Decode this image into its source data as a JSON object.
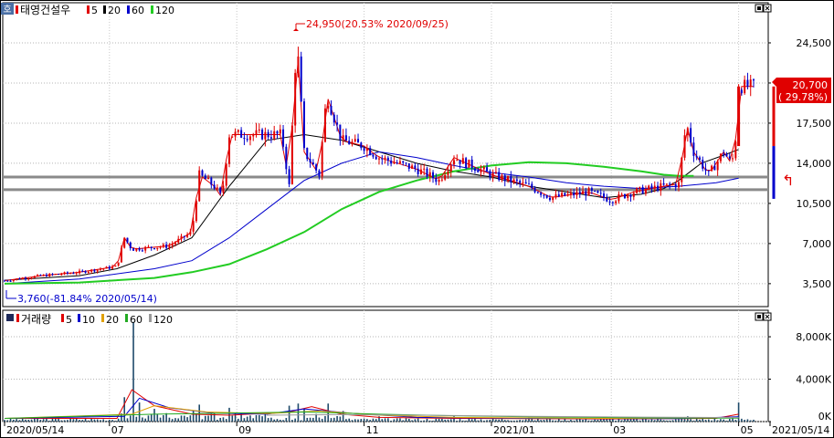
{
  "price_panel": {
    "badge": "호",
    "legend": {
      "name": "태영건설우",
      "ma_labels": [
        "5",
        "20",
        "60",
        "120"
      ],
      "ma_colors": [
        "#e00000",
        "#000000",
        "#0000cc",
        "#22cc22"
      ]
    },
    "y_ticks": [
      "24,500",
      "21,000",
      "17,500",
      "14,000",
      "10,500",
      "7,000",
      "3,500"
    ],
    "y_tick_values": [
      24500,
      21000,
      17500,
      14000,
      10500,
      7000,
      3500
    ],
    "ylim": [
      1500,
      28000
    ],
    "high_annotation": "24,950(20.53% 2020/09/25)",
    "low_annotation": "3,760(-81.84% 2020/05/14)",
    "current_price": "20,700",
    "current_change": "( 29.78%)",
    "arrow_glyph": "↰"
  },
  "volume_panel": {
    "legend": {
      "name": "거래량",
      "ma_labels": [
        "5",
        "10",
        "20",
        "60",
        "120"
      ],
      "ma_colors": [
        "#e00000",
        "#0000cc",
        "#e0a000",
        "#22aa22",
        "#999999"
      ]
    },
    "y_ticks": [
      "8,000K",
      "4,000K",
      "0K"
    ],
    "y_tick_values": [
      8000,
      4000,
      0
    ],
    "ylim": [
      0,
      10500
    ]
  },
  "x_axis": {
    "labels": [
      "2020/05/14",
      "07",
      "09",
      "11",
      "2021/01",
      "03",
      "05",
      "2021/05/14"
    ],
    "positions": [
      0,
      0.14,
      0.31,
      0.48,
      0.65,
      0.81,
      0.98,
      1.0
    ]
  },
  "chart_data": [
    {
      "type": "candlestick",
      "title": "태영건설우",
      "series": [
        {
          "name": "5",
          "color": "#e00000"
        },
        {
          "name": "20",
          "color": "#000000"
        },
        {
          "name": "60",
          "color": "#0000cc"
        },
        {
          "name": "120",
          "color": "#22cc22"
        }
      ],
      "x_range": [
        "2020/05/14",
        "2021/05/14"
      ],
      "ylim": [
        1500,
        28000
      ],
      "y_ticks": [
        24500,
        21000,
        17500,
        14000,
        10500,
        7000,
        3500
      ],
      "x_ticks": [
        "2020/05/14",
        "07",
        "09",
        "11",
        "2021/01",
        "03",
        "05",
        "2021/05/14"
      ],
      "price_path": [
        [
          0,
          3760
        ],
        [
          0.05,
          4200
        ],
        [
          0.1,
          4500
        ],
        [
          0.15,
          5000
        ],
        [
          0.16,
          7500
        ],
        [
          0.17,
          6500
        ],
        [
          0.22,
          6800
        ],
        [
          0.25,
          8000
        ],
        [
          0.26,
          13000
        ],
        [
          0.28,
          12000
        ],
        [
          0.29,
          11000
        ],
        [
          0.3,
          16500
        ],
        [
          0.31,
          16500
        ],
        [
          0.37,
          16500
        ],
        [
          0.38,
          12000
        ],
        [
          0.39,
          24950
        ],
        [
          0.4,
          15000
        ],
        [
          0.42,
          13000
        ],
        [
          0.43,
          20000
        ],
        [
          0.45,
          16000
        ],
        [
          0.48,
          15500
        ],
        [
          0.5,
          14500
        ],
        [
          0.55,
          13500
        ],
        [
          0.58,
          12500
        ],
        [
          0.6,
          14500
        ],
        [
          0.65,
          13000
        ],
        [
          0.7,
          12000
        ],
        [
          0.73,
          11000
        ],
        [
          0.78,
          11500
        ],
        [
          0.81,
          10800
        ],
        [
          0.84,
          11500
        ],
        [
          0.88,
          12000
        ],
        [
          0.9,
          12200
        ],
        [
          0.91,
          17500
        ],
        [
          0.92,
          15000
        ],
        [
          0.94,
          13000
        ],
        [
          0.96,
          15000
        ],
        [
          0.97,
          14000
        ],
        [
          0.975,
          15000
        ],
        [
          0.98,
          20700
        ]
      ],
      "ma_paths": {
        "20": [
          [
            0,
            3800
          ],
          [
            0.1,
            4200
          ],
          [
            0.15,
            4800
          ],
          [
            0.2,
            6000
          ],
          [
            0.25,
            7500
          ],
          [
            0.3,
            12000
          ],
          [
            0.35,
            16000
          ],
          [
            0.4,
            16500
          ],
          [
            0.45,
            16000
          ],
          [
            0.5,
            15000
          ],
          [
            0.55,
            14000
          ],
          [
            0.6,
            13300
          ],
          [
            0.65,
            12800
          ],
          [
            0.7,
            12000
          ],
          [
            0.75,
            11500
          ],
          [
            0.8,
            11000
          ],
          [
            0.85,
            11300
          ],
          [
            0.88,
            11800
          ],
          [
            0.9,
            12500
          ],
          [
            0.93,
            14000
          ],
          [
            0.96,
            14700
          ],
          [
            0.98,
            15200
          ]
        ],
        "60": [
          [
            0,
            3500
          ],
          [
            0.1,
            3900
          ],
          [
            0.2,
            4800
          ],
          [
            0.25,
            5500
          ],
          [
            0.3,
            7500
          ],
          [
            0.35,
            10000
          ],
          [
            0.4,
            12500
          ],
          [
            0.45,
            14000
          ],
          [
            0.5,
            15000
          ],
          [
            0.55,
            14500
          ],
          [
            0.6,
            13800
          ],
          [
            0.65,
            13200
          ],
          [
            0.7,
            12800
          ],
          [
            0.75,
            12300
          ],
          [
            0.8,
            12000
          ],
          [
            0.85,
            11800
          ],
          [
            0.9,
            12000
          ],
          [
            0.95,
            12300
          ],
          [
            0.98,
            12700
          ]
        ],
        "120": [
          [
            0,
            3500
          ],
          [
            0.1,
            3600
          ],
          [
            0.2,
            4000
          ],
          [
            0.25,
            4500
          ],
          [
            0.3,
            5200
          ],
          [
            0.35,
            6500
          ],
          [
            0.4,
            8000
          ],
          [
            0.45,
            10000
          ],
          [
            0.5,
            11500
          ],
          [
            0.55,
            12500
          ],
          [
            0.6,
            13300
          ],
          [
            0.65,
            13800
          ],
          [
            0.7,
            14100
          ],
          [
            0.75,
            14000
          ],
          [
            0.8,
            13700
          ],
          [
            0.85,
            13300
          ],
          [
            0.88,
            13000
          ],
          [
            0.9,
            12900
          ],
          [
            0.92,
            12900
          ]
        ]
      },
      "support_lines": [
        12800,
        11700
      ]
    },
    {
      "type": "bar",
      "title": "거래량",
      "series": [
        {
          "name": "5",
          "color": "#e00000"
        },
        {
          "name": "10",
          "color": "#0000cc"
        },
        {
          "name": "20",
          "color": "#e0a000"
        },
        {
          "name": "60",
          "color": "#22aa22"
        },
        {
          "name": "120",
          "color": "#999999"
        }
      ],
      "unit": "K",
      "ylim": [
        0,
        10500
      ],
      "y_ticks": [
        8000,
        4000,
        0
      ],
      "spikes": [
        [
          0.16,
          2300
        ],
        [
          0.17,
          9400
        ],
        [
          0.18,
          1800
        ],
        [
          0.2,
          1200
        ],
        [
          0.25,
          1000
        ],
        [
          0.26,
          1600
        ],
        [
          0.28,
          800
        ],
        [
          0.3,
          1300
        ],
        [
          0.38,
          1500
        ],
        [
          0.39,
          1700
        ],
        [
          0.4,
          1200
        ],
        [
          0.43,
          1700
        ],
        [
          0.45,
          1000
        ],
        [
          0.5,
          500
        ],
        [
          0.6,
          500
        ],
        [
          0.7,
          400
        ],
        [
          0.8,
          400
        ],
        [
          0.91,
          500
        ],
        [
          0.98,
          1800
        ]
      ]
    }
  ]
}
